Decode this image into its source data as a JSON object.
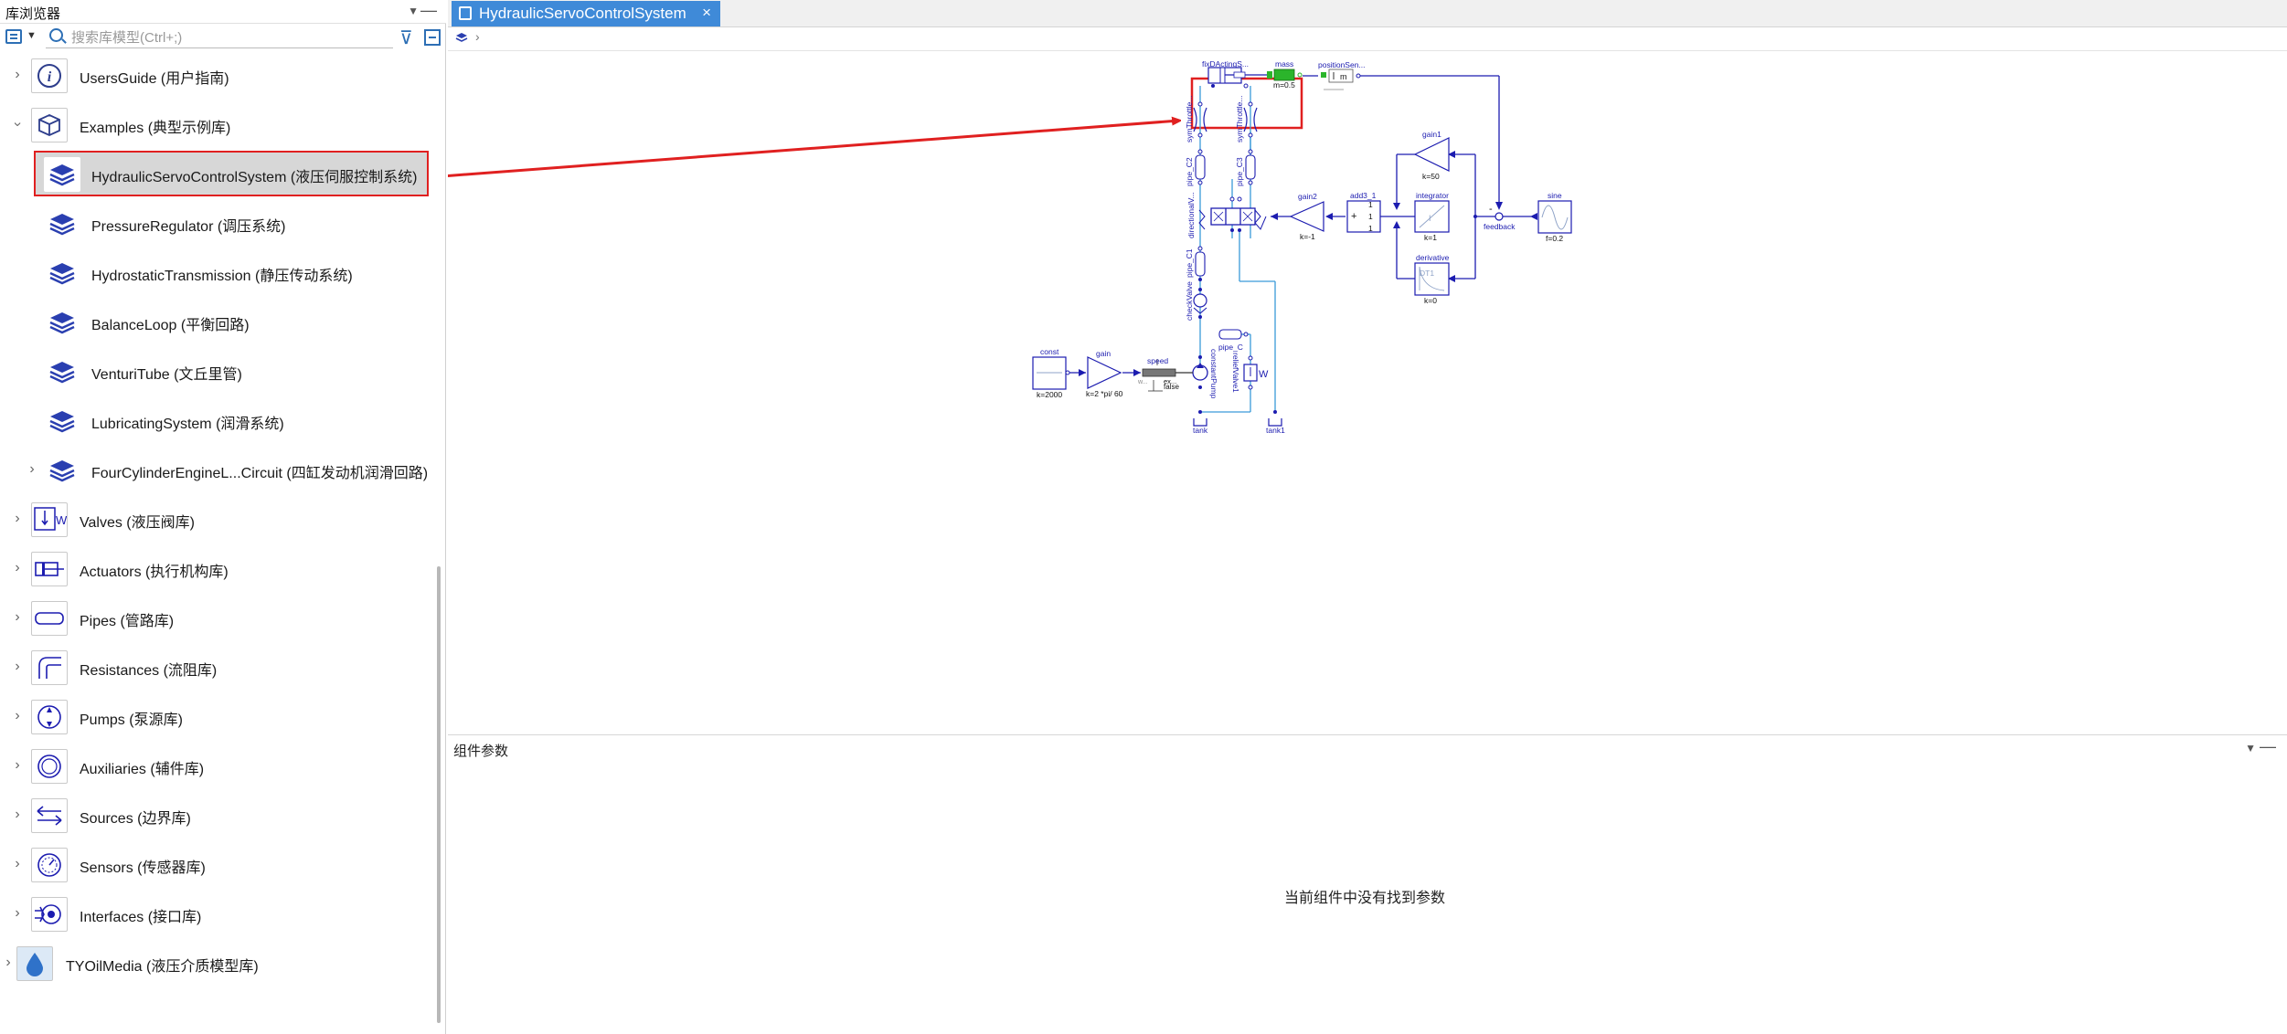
{
  "library": {
    "title": "库浏览器",
    "search_placeholder": "搜索库模型(Ctrl+;)",
    "items": [
      {
        "label": "UsersGuide (用户指南)"
      },
      {
        "label": "Examples (典型示例库)"
      },
      {
        "label": "HydraulicServoControlSystem (液压伺服控制系统)"
      },
      {
        "label": "PressureRegulator (调压系统)"
      },
      {
        "label": "HydrostaticTransmission (静压传动系统)"
      },
      {
        "label": "BalanceLoop (平衡回路)"
      },
      {
        "label": "VenturiTube (文丘里管)"
      },
      {
        "label": "LubricatingSystem (润滑系统)"
      },
      {
        "label": "FourCylinderEngineL...Circuit (四缸发动机润滑回路)"
      },
      {
        "label": "Valves (液压阀库)"
      },
      {
        "label": "Actuators (执行机构库)"
      },
      {
        "label": "Pipes (管路库)"
      },
      {
        "label": "Resistances (流阻库)"
      },
      {
        "label": "Pumps (泵源库)"
      },
      {
        "label": "Auxiliaries (辅件库)"
      },
      {
        "label": "Sources (边界库)"
      },
      {
        "label": "Sensors (传感器库)"
      },
      {
        "label": "Interfaces (接口库)"
      },
      {
        "label": "TYOilMedia (液压介质模型库)"
      }
    ]
  },
  "editor": {
    "tab_title": "HydraulicServoControlSystem",
    "tab_close": "×"
  },
  "diagram": {
    "labels": {
      "fixDActing": "fixDActingS...",
      "mass": "mass",
      "mass_param": "m=0.5",
      "positionSen": "positionSen...",
      "m_box": "m",
      "symThrottle1": "symThrottle...",
      "symThrottle2": "symThrottle...",
      "pipe_C2": "pipe_C2",
      "pipe_C3": "pipe_C3",
      "gain1": "gain1",
      "gain1_k": "k=50",
      "gain2": "gain2",
      "gain2_k": "k=-1",
      "add3_1": "add3_1",
      "add_plus": "+",
      "add_1a": "1",
      "add_1b": "1",
      "add_1c": "1",
      "integrator": "integrator",
      "integrator_k": "k=1",
      "integrator_sym": "I",
      "feedback": "feedback",
      "feedback_minus": "-",
      "sine": "sine",
      "sine_f": "f=0.2",
      "derivative": "derivative",
      "derivative_k": "k=0",
      "derivative_sym": "DT1",
      "directionalV": "directionalV...",
      "pipe_C1": "pipe_C1",
      "checkValve": "checkValve",
      "pipe_C": "pipe_C",
      "constantPump": "constantPump",
      "reliefValve1": "reliefValve1",
      "const": "const",
      "const_k": "k=2000",
      "gain": "gain",
      "gain_k": "k=2 *pi/ 60",
      "speed": "speed",
      "speed_w": "w...",
      "speed_ex": "ex...",
      "speed_false": "false",
      "tank": "tank",
      "tank1": "tank1",
      "W_letter": "W"
    }
  },
  "params": {
    "title": "组件参数",
    "empty_message": "当前组件中没有找到参数"
  },
  "colors": {
    "accent": "#3f8ad8",
    "diagram_blue": "#1c1cb0",
    "wire_light": "#3a9ad9",
    "highlight_red": "#e02020",
    "mass_green": "#2bb52b"
  }
}
